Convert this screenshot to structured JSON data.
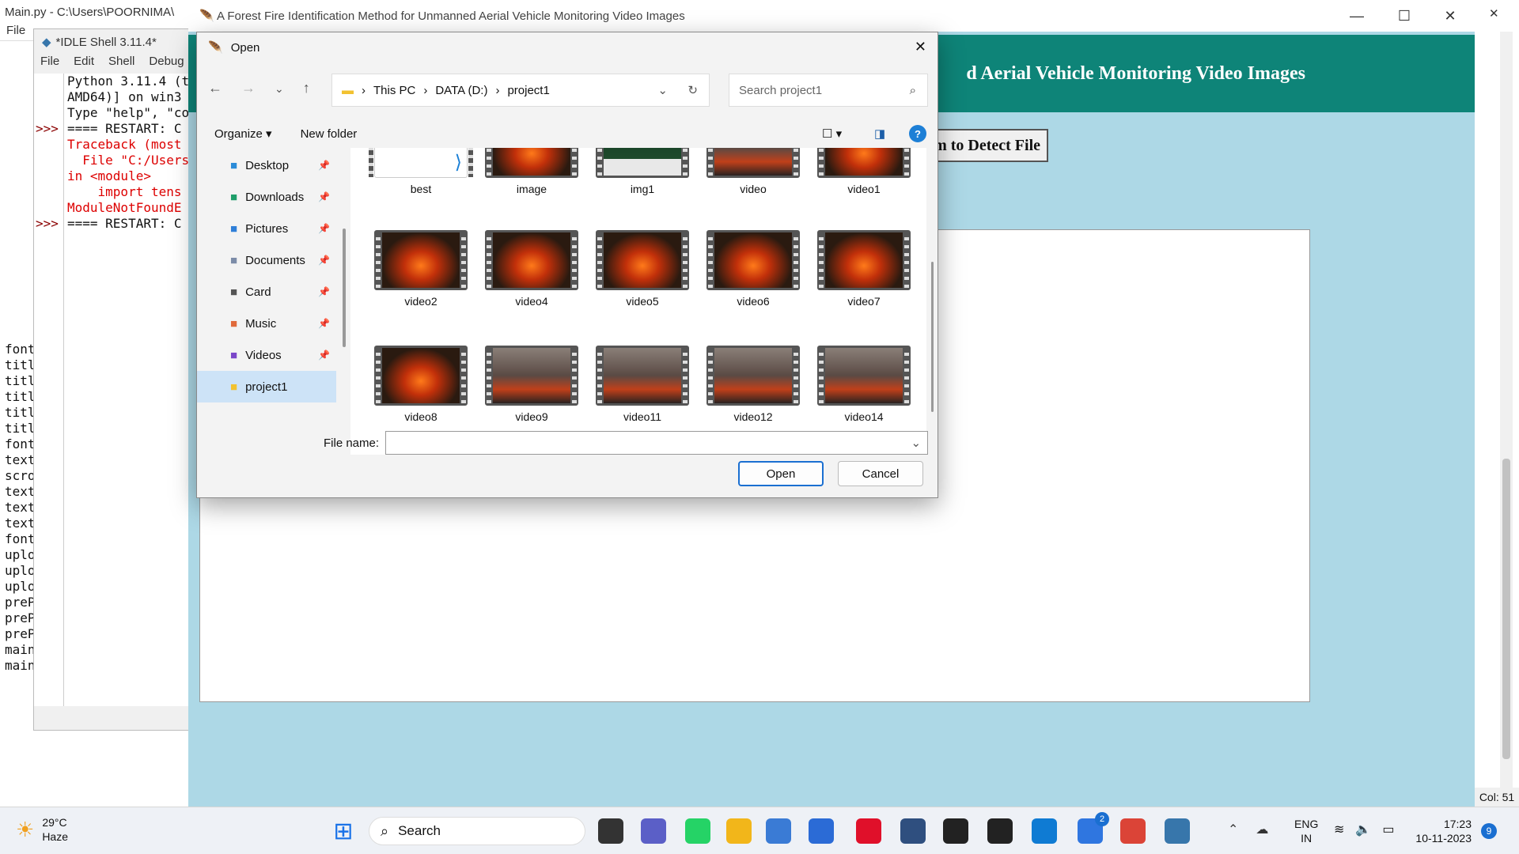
{
  "editor": {
    "title": "Main.py - C:\\Users\\POORNIMA\\",
    "menu": "File",
    "lines": [
      "font",
      "titl",
      "titl",
      "titl",
      "titl",
      "titl",
      "",
      "font",
      "text",
      "scro",
      "text",
      "text",
      "text",
      "",
      "",
      "font",
      "uplo",
      "uplo",
      "uplo",
      "",
      "preP",
      "preP",
      "preP",
      "",
      "",
      "main.config(bg='LightBl",
      "main.mainloop()"
    ]
  },
  "shell": {
    "title": "*IDLE Shell 3.11.4*",
    "menu": [
      "File",
      "Edit",
      "Shell",
      "Debug"
    ],
    "prompts": [
      ">>>",
      "",
      ">>>"
    ],
    "lines": [
      "Python 3.11.4 (t",
      "AMD64)] on win3",
      "Type \"help\", \"co",
      "",
      "==== RESTART: C",
      "Traceback (most",
      "  File \"C:/Users",
      "in <module>",
      "    import tens",
      "ModuleNotFoundE",
      "",
      "==== RESTART: C"
    ]
  },
  "app": {
    "title": "A Forest Fire Identification Method for Unmanned Aerial Vehicle Monitoring Video Images",
    "banner": "d Aerial Vehicle Monitoring Video Images",
    "detect_button": "om to Detect File",
    "status": "Col: 51"
  },
  "dialog": {
    "title": "Open",
    "breadcrumb": [
      "This PC",
      "DATA (D:)",
      "project1"
    ],
    "search_placeholder": "Search project1",
    "organize": "Organize",
    "new_folder": "New folder",
    "nav": [
      {
        "label": "Desktop",
        "icon": "desktop-icon",
        "color": "#2a8bd8"
      },
      {
        "label": "Downloads",
        "icon": "download-icon",
        "color": "#1f9e6a"
      },
      {
        "label": "Pictures",
        "icon": "pictures-icon",
        "color": "#2f7fd8"
      },
      {
        "label": "Documents",
        "icon": "documents-icon",
        "color": "#7c8ca8"
      },
      {
        "label": "Card",
        "icon": "drive-icon",
        "color": "#555"
      },
      {
        "label": "Music",
        "icon": "music-icon",
        "color": "#e06a3b"
      },
      {
        "label": "Videos",
        "icon": "videos-icon",
        "color": "#7b47c9"
      },
      {
        "label": "project1",
        "icon": "folder-icon",
        "color": "#f2c230"
      }
    ],
    "files": [
      {
        "name": "best",
        "kind": "vscode"
      },
      {
        "name": "image",
        "kind": "fire"
      },
      {
        "name": "img1",
        "kind": "forest"
      },
      {
        "name": "video",
        "kind": "smoke"
      },
      {
        "name": "video1",
        "kind": "fire"
      },
      {
        "name": "video2",
        "kind": "fire"
      },
      {
        "name": "video4",
        "kind": "fire"
      },
      {
        "name": "video5",
        "kind": "fire"
      },
      {
        "name": "video6",
        "kind": "fire"
      },
      {
        "name": "video7",
        "kind": "fire"
      },
      {
        "name": "video8",
        "kind": "fire"
      },
      {
        "name": "video9",
        "kind": "smoke"
      },
      {
        "name": "video11",
        "kind": "smoke"
      },
      {
        "name": "video12",
        "kind": "smoke"
      },
      {
        "name": "video14",
        "kind": "smoke"
      }
    ],
    "filename_label": "File name:",
    "filename_value": "",
    "open_button": "Open",
    "cancel_button": "Cancel"
  },
  "taskbar": {
    "weather_temp": "29°C",
    "weather_desc": "Haze",
    "search": "Search",
    "lang1": "ENG",
    "lang2": "IN",
    "time": "17:23",
    "date": "10-11-2023",
    "notification_count": "9",
    "todo_badge": "2",
    "apps": [
      {
        "icon": "start-icon",
        "color": "#1a73e8"
      },
      {
        "icon": "task-view-icon",
        "color": "#333"
      },
      {
        "icon": "teams-icon",
        "color": "#5b5fc7"
      },
      {
        "icon": "whatsapp-icon",
        "color": "#25d366"
      },
      {
        "icon": "file-explorer-icon",
        "color": "#f2b61a"
      },
      {
        "icon": "notepad-icon",
        "color": "#3a7bd5"
      },
      {
        "icon": "store-icon",
        "color": "#2b6bd6"
      },
      {
        "icon": "opera-icon",
        "color": "#e0102a"
      },
      {
        "icon": "devc-icon",
        "color": "#2f4f7f"
      },
      {
        "icon": "terminal-icon",
        "color": "#222"
      },
      {
        "icon": "sticky-notes-icon",
        "color": "#222"
      },
      {
        "icon": "edge-icon",
        "color": "#0f7bd3"
      },
      {
        "icon": "todo-icon",
        "color": "#2f76e0"
      },
      {
        "icon": "chrome-icon",
        "color": "#db4437"
      },
      {
        "icon": "python-icon",
        "color": "#3776ab"
      }
    ]
  }
}
